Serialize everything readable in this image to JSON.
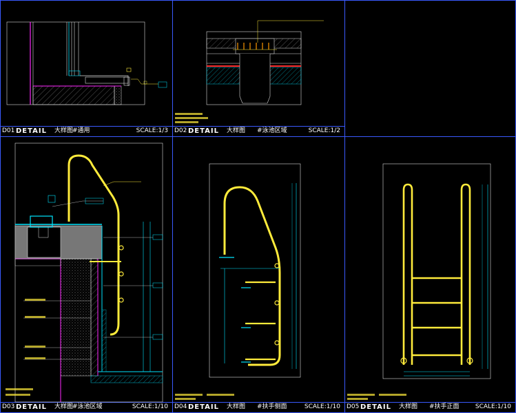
{
  "colors": {
    "frame": "#3a5aff",
    "yellow": "#ffeb3b",
    "cyan": "#00e5ff",
    "magenta": "#ff29ff",
    "red": "#ff2a2a",
    "white": "#ffffff"
  },
  "panels": [
    {
      "code": "D01",
      "detail": "DETAIL",
      "big": "大样图",
      "loc": "#通用",
      "scale": "SCALE:1/3"
    },
    {
      "code": "D02",
      "detail": "DETAIL",
      "big": "大样图",
      "loc": "#泳池区域",
      "scale": "SCALE:1/2"
    },
    {
      "code": "D03",
      "detail": "DETAIL",
      "big": "大样图",
      "loc": "#泳池区域",
      "scale": "SCALE:1/10"
    },
    {
      "code": "D04",
      "detail": "DETAIL",
      "big": "大样图",
      "loc": "#扶手侧面",
      "scale": "SCALE:1/10"
    },
    {
      "code": "D05",
      "detail": "DETAIL",
      "big": "大样图",
      "loc": "#扶手正面",
      "scale": "SCALE:1/10"
    }
  ]
}
